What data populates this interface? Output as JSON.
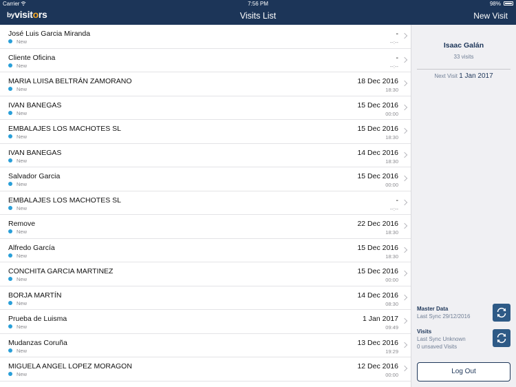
{
  "status_bar": {
    "carrier": "Carrier",
    "time": "7:56 PM",
    "battery": "98%"
  },
  "header": {
    "logo": {
      "by": "by",
      "pre": "visit",
      "accent": "o",
      "post": "rs"
    },
    "title": "Visits List",
    "new_visit_label": "New Visit"
  },
  "visits": [
    {
      "name": "José Luis Garcia Miranda",
      "status": "New",
      "date": "-",
      "time": "--:--"
    },
    {
      "name": "Cliente Oficina",
      "status": "New",
      "date": "-",
      "time": "--:--"
    },
    {
      "name": "MARIA LUISA BELTRÁN ZAMORANO",
      "status": "New",
      "date": "18 Dec 2016",
      "time": "18:30"
    },
    {
      "name": "IVAN BANEGAS",
      "status": "New",
      "date": "15 Dec 2016",
      "time": "00:00"
    },
    {
      "name": "EMBALAJES LOS MACHOTES SL",
      "status": "New",
      "date": "15 Dec 2016",
      "time": "18:30"
    },
    {
      "name": "IVAN BANEGAS",
      "status": "New",
      "date": "14 Dec 2016",
      "time": "18:30"
    },
    {
      "name": "Salvador Garcia",
      "status": "New",
      "date": "15 Dec 2016",
      "time": "00:00"
    },
    {
      "name": "EMBALAJES LOS MACHOTES SL",
      "status": "New",
      "date": "-",
      "time": "--:--"
    },
    {
      "name": "Remove",
      "status": "New",
      "date": "22 Dec 2016",
      "time": "18:30"
    },
    {
      "name": "Alfredo García",
      "status": "New",
      "date": "15 Dec 2016",
      "time": "18:30"
    },
    {
      "name": "CONCHITA GARCIA MARTINEZ",
      "status": "New",
      "date": "15 Dec 2016",
      "time": "00:00"
    },
    {
      "name": "BORJA MARTÍN",
      "status": "New",
      "date": "14 Dec 2016",
      "time": "08:30"
    },
    {
      "name": "Prueba de Luisma",
      "status": "New",
      "date": "1 Jan 2017",
      "time": "09:49"
    },
    {
      "name": "Mudanzas Coruña",
      "status": "New",
      "date": "13 Dec 2016",
      "time": "19:29"
    },
    {
      "name": "MIGUELA ANGEL LOPEZ MORAGON",
      "status": "New",
      "date": "12 Dec 2016",
      "time": "00:00"
    }
  ],
  "sidebar": {
    "user_name": "Isaac Galán",
    "visit_count": "33 visits",
    "next_visit_label": "Next Visit",
    "next_visit_date": "1 Jan 2017",
    "master_data": {
      "title": "Master Data",
      "last_sync": "Last Sync 29/12/2016"
    },
    "visits_sync": {
      "title": "Visits",
      "last_sync": "Last Sync Unknown",
      "unsaved": "0 unsaved Visits"
    },
    "logout_label": "Log Out"
  },
  "colors": {
    "header_bg": "#1c3558",
    "status_dot": "#2a9fd8",
    "sync_button": "#2e5a86",
    "logo_accent": "#f5a623"
  },
  "icons": {
    "status": "wifi-icon",
    "sync": "sync-icon",
    "row": "chevron-right-icon"
  }
}
